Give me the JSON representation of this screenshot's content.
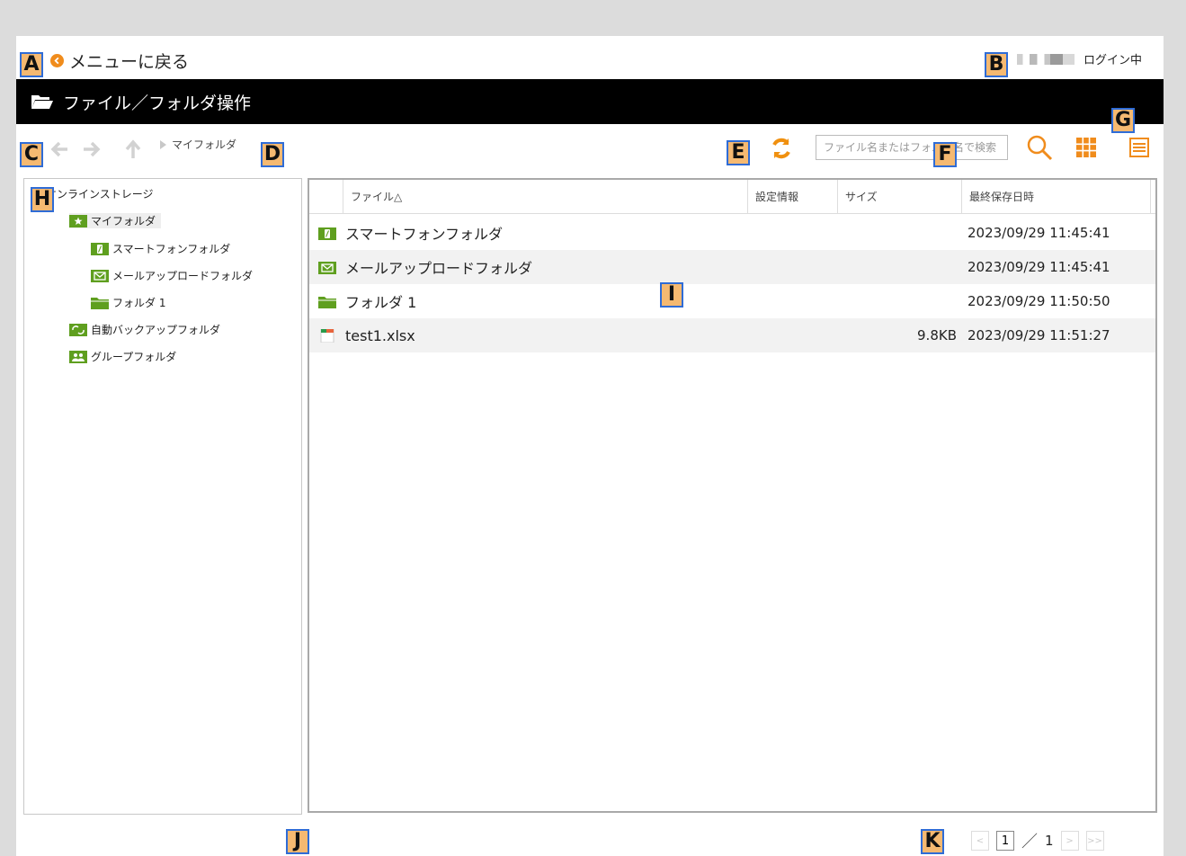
{
  "header": {
    "back_label": "メニューに戻る",
    "login_status": "ログイン中"
  },
  "title": "ファイル／フォルダ操作",
  "toolbar": {
    "breadcrumb": "マイフォルダ",
    "search_placeholder": "ファイル名またはフォルダ名で検索"
  },
  "tree": {
    "root": "オンラインストレージ",
    "items": [
      {
        "label": "マイフォルダ",
        "icon": "star-folder-icon"
      },
      {
        "label": "スマートフォンフォルダ",
        "icon": "smartphone-folder-icon"
      },
      {
        "label": "メールアップロードフォルダ",
        "icon": "mail-folder-icon"
      },
      {
        "label": "フォルダ 1",
        "icon": "folder-icon"
      },
      {
        "label": "自動バックアップフォルダ",
        "icon": "backup-folder-icon"
      },
      {
        "label": "グループフォルダ",
        "icon": "group-folder-icon"
      }
    ]
  },
  "list": {
    "columns": [
      "ファイル△",
      "設定情報",
      "サイズ",
      "最終保存日時"
    ],
    "rows": [
      {
        "name": "スマートフォンフォルダ",
        "size": "",
        "date": "2023/09/29 11:45:41"
      },
      {
        "name": "メールアップロードフォルダ",
        "size": "",
        "date": "2023/09/29 11:45:41"
      },
      {
        "name": "フォルダ 1",
        "size": "",
        "date": "2023/09/29 11:50:50"
      },
      {
        "name": "test1.xlsx",
        "size": "9.8KB",
        "date": "2023/09/29 11:51:27"
      }
    ]
  },
  "pager": {
    "current": "1",
    "total": "1",
    "separator": "／",
    "first": "<",
    "next": ">",
    "last": ">>"
  },
  "markers": [
    "A",
    "B",
    "C",
    "D",
    "E",
    "F",
    "G",
    "H",
    "I",
    "J",
    "K"
  ],
  "colors": {
    "accent_orange": "#f08c1c",
    "folder_green": "#5f9f1f",
    "title_bg": "#000000"
  }
}
